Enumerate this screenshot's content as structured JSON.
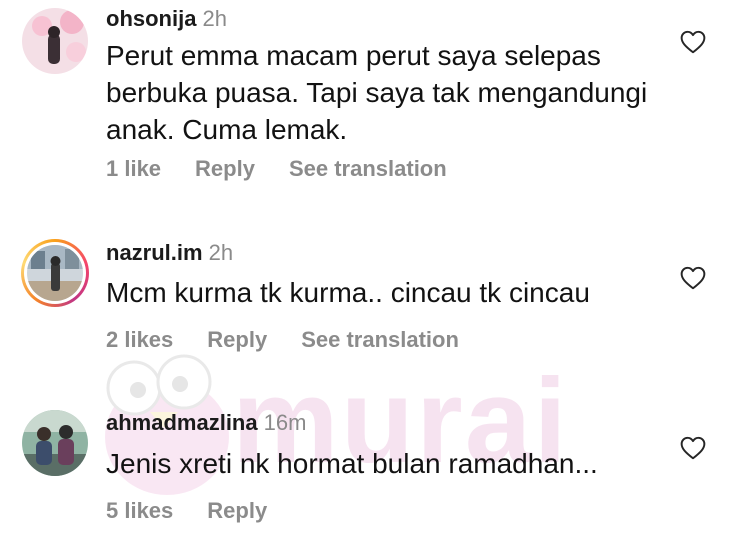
{
  "comments": [
    {
      "username": "ohsonija",
      "time": "2h",
      "text": "Perut emma macam perut saya selepas berbuka puasa. Tapi saya tak mengandungi anak. Cuma lemak.",
      "likes": "1 like",
      "reply": "Reply",
      "translate": "See translation",
      "story_ring": false
    },
    {
      "username": "nazrul.im",
      "time": "2h",
      "text": "Mcm kurma tk kurma.. cincau tk cincau",
      "likes": "2 likes",
      "reply": "Reply",
      "translate": "See translation",
      "story_ring": true
    },
    {
      "username": "ahmadmazlina",
      "time": "16m",
      "text": "Jenis xreti nk hormat bulan ramadhan...",
      "likes": "5 likes",
      "reply": "Reply",
      "story_ring": false
    }
  ],
  "watermark": {
    "text": "murai"
  },
  "colors": {
    "story_ring": "#f5456b",
    "muted": "#8b8b8b",
    "watermark": "#d36ab2"
  },
  "icons": {
    "like": "heart-outline-icon"
  }
}
